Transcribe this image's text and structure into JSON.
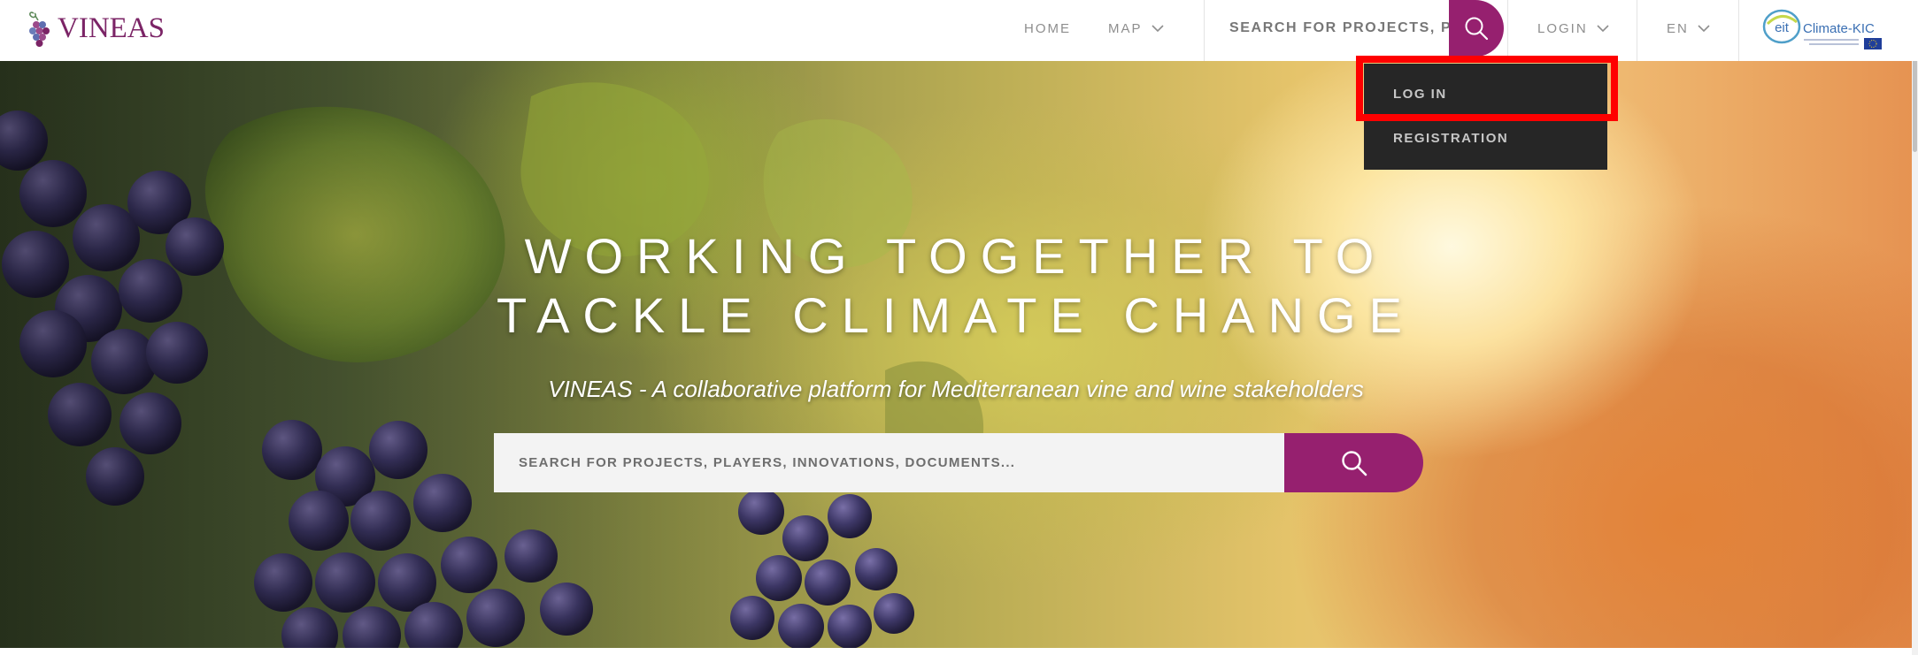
{
  "header": {
    "logo_text": "VINEAS",
    "nav": {
      "home": "HOME",
      "map": "MAP",
      "login": "LOGIN",
      "language": "EN"
    },
    "search": {
      "placeholder": "SEARCH FOR PROJECTS, PLAYERS, INNOVATIONS, DOCUMENTS..."
    },
    "partner_logo": {
      "text": "Climate-KIC",
      "badge": "eit"
    }
  },
  "login_menu": {
    "items": [
      {
        "label": "LOG IN",
        "highlighted": true
      },
      {
        "label": "REGISTRATION",
        "highlighted": false
      }
    ]
  },
  "hero": {
    "title_line1": "WORKING TOGETHER TO",
    "title_line2": "TACKLE CLIMATE CHANGE",
    "subtitle": "VINEAS - A collaborative platform for Mediterranean vine and wine stakeholders",
    "search": {
      "placeholder": "SEARCH FOR PROJECTS, PLAYERS, INNOVATIONS, DOCUMENTS..."
    }
  },
  "colors": {
    "brand": "#96206f",
    "dropdown_bg": "#262626",
    "nav_text": "#8e8e8e",
    "highlight": "#ff0000"
  },
  "icons": {
    "logo": "grape-cluster-icon",
    "search": "search-icon",
    "chevron": "chevron-down-icon"
  }
}
